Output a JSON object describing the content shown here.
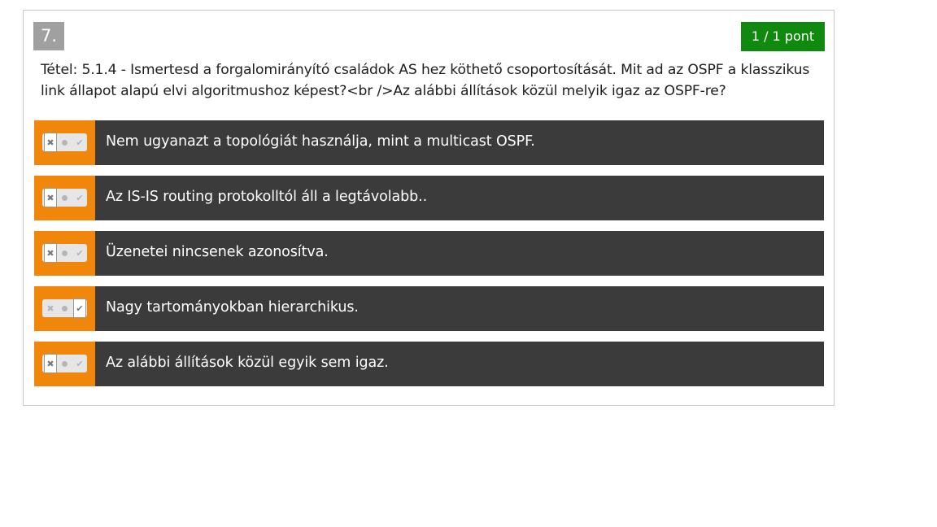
{
  "question": {
    "number": "7.",
    "score": "1 / 1 pont",
    "text": "Tétel: 5.1.4 - Ismertesd a forgalomirányító családok AS hez köthető csoportosítását. Mit ad az OSPF a klasszikus link állapot alapú elvi algoritmushoz képest?<br />Az alábbi állítások közül melyik igaz az OSPF-re?"
  },
  "answers": [
    {
      "text": "Nem ugyanazt a topológiát használja, mint a multicast OSPF.",
      "state": "false"
    },
    {
      "text": "Az IS-IS routing protokolltól áll a legtávolabb..",
      "state": "false"
    },
    {
      "text": "Üzenetei nincsenek azonosítva.",
      "state": "false"
    },
    {
      "text": "Nagy tartományokban hierarchikus.",
      "state": "true"
    },
    {
      "text": "Az alábbi állítások közül egyik sem igaz.",
      "state": "false"
    }
  ],
  "icons": {
    "false_mark": "✖",
    "true_mark": "✔"
  },
  "colors": {
    "score_badge": "#0f8a0f",
    "number_badge": "#a0a0a0",
    "answer_bg": "#3b3b3b",
    "toggle_bg": "#f0870a"
  }
}
